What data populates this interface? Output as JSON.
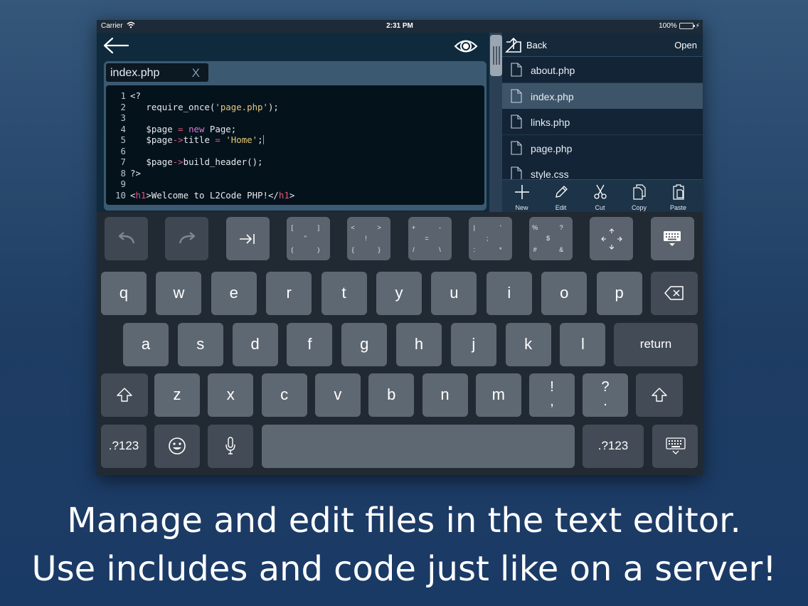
{
  "status_bar": {
    "carrier": "Carrier",
    "time": "2:31 PM",
    "battery": "100%",
    "battery_level": 1.0
  },
  "editor": {
    "tab": {
      "label": "index.php",
      "close": "X"
    },
    "lines": [
      {
        "n": "1",
        "parts": [
          {
            "t": "<?"
          }
        ]
      },
      {
        "n": "2",
        "parts": [
          {
            "t": "   require_once("
          },
          {
            "t": "'page.php'",
            "c": "str"
          },
          {
            "t": ");"
          }
        ]
      },
      {
        "n": "3",
        "parts": []
      },
      {
        "n": "4",
        "parts": [
          {
            "t": "   $page "
          },
          {
            "t": "=",
            "c": "op"
          },
          {
            "t": " "
          },
          {
            "t": "new",
            "c": "kw"
          },
          {
            "t": " Page;"
          }
        ]
      },
      {
        "n": "5",
        "parts": [
          {
            "t": "   $page"
          },
          {
            "t": "->",
            "c": "op"
          },
          {
            "t": "title "
          },
          {
            "t": "=",
            "c": "op"
          },
          {
            "t": " "
          },
          {
            "t": "'Home'",
            "c": "str"
          },
          {
            "t": ";"
          }
        ],
        "cursor": true
      },
      {
        "n": "6",
        "parts": []
      },
      {
        "n": "7",
        "parts": [
          {
            "t": "   $page"
          },
          {
            "t": "->",
            "c": "op"
          },
          {
            "t": "build_header();"
          }
        ]
      },
      {
        "n": "8",
        "parts": [
          {
            "t": "?>"
          }
        ]
      },
      {
        "n": "9",
        "parts": []
      },
      {
        "n": "10",
        "parts": [
          {
            "t": "<"
          },
          {
            "t": "h1",
            "c": "op"
          },
          {
            "t": ">Welcome to L2Code PHP!</"
          },
          {
            "t": "h1",
            "c": "op"
          },
          {
            "t": ">"
          }
        ]
      }
    ]
  },
  "browser": {
    "back_label": "Back",
    "open_label": "Open",
    "files": [
      {
        "name": "about.php",
        "selected": false
      },
      {
        "name": "index.php",
        "selected": true
      },
      {
        "name": "links.php",
        "selected": false
      },
      {
        "name": "page.php",
        "selected": false
      },
      {
        "name": "style.css",
        "selected": false
      }
    ],
    "tools": [
      {
        "label": "New",
        "icon": "plus-icon"
      },
      {
        "label": "Edit",
        "icon": "pencil-icon"
      },
      {
        "label": "Cut",
        "icon": "scissors-icon"
      },
      {
        "label": "Copy",
        "icon": "copy-icon"
      },
      {
        "label": "Paste",
        "icon": "paste-icon"
      }
    ]
  },
  "keyboard": {
    "toolbar": [
      {
        "name": "undo-key",
        "icon": "undo-icon",
        "dim": true
      },
      {
        "name": "redo-key",
        "icon": "redo-icon",
        "dim": true
      },
      {
        "name": "tab-key",
        "icon": "tab-icon"
      },
      {
        "name": "brackets-key",
        "symbols": [
          "[",
          "]",
          "\"",
          "(",
          ")"
        ]
      },
      {
        "name": "angle-key",
        "symbols": [
          "<",
          ">",
          "!",
          "{",
          "}"
        ]
      },
      {
        "name": "math-key",
        "symbols": [
          "+",
          "-",
          "=",
          "/",
          "\\"
        ]
      },
      {
        "name": "punct-key",
        "symbols": [
          "|",
          "'",
          ";",
          ":",
          "*"
        ]
      },
      {
        "name": "special-key",
        "symbols": [
          "%",
          "?",
          "$",
          "#",
          "&"
        ]
      },
      {
        "name": "arrows-key",
        "icon": "arrows-icon"
      },
      {
        "name": "hide-keyboard-key",
        "icon": "keyboard-dismiss-icon"
      }
    ],
    "row1": [
      "q",
      "w",
      "e",
      "r",
      "t",
      "y",
      "u",
      "i",
      "o",
      "p"
    ],
    "row2": [
      "a",
      "s",
      "d",
      "f",
      "g",
      "h",
      "j",
      "k",
      "l"
    ],
    "row3": [
      "z",
      "x",
      "c",
      "v",
      "b",
      "n",
      "m"
    ],
    "row3_punct": [
      {
        "top": "!",
        "bottom": ","
      },
      {
        "top": "?",
        "bottom": "."
      }
    ],
    "return_label": "return",
    "numbers_label": ".?123"
  },
  "caption": {
    "line1": "Manage and edit files in the text editor.",
    "line2": "Use includes and code just like on a server!"
  }
}
